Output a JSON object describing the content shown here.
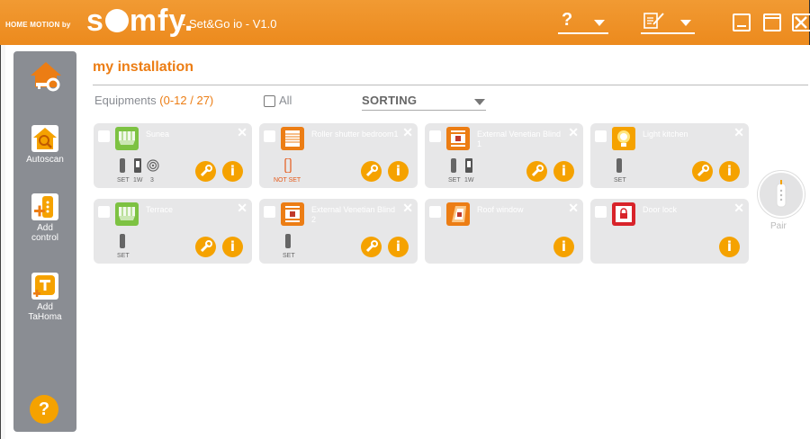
{
  "titlebar": {
    "brand_small": "HOME MOTION by",
    "brand_logo": "somfy.",
    "app_title": "- Set&Go io - V1.0",
    "help_button": "?",
    "edit_icon": "edit-icon",
    "window_buttons": [
      "minimize-icon",
      "maximize-icon",
      "close-icon"
    ],
    "accent_color": "#ec8a1d"
  },
  "sidebar": {
    "home_icon": "home-key-icon",
    "items": [
      {
        "label": "Autoscan",
        "icon": "autoscan-icon"
      },
      {
        "label": "Add control",
        "icon": "add-control-icon"
      },
      {
        "label": "Add TaHoma",
        "icon": "add-tahoma-icon"
      }
    ],
    "help": "?"
  },
  "main": {
    "heading": "my installation",
    "equipments_label": "Equipments",
    "equipments_count": "(0-12 / 27)",
    "all_label": "All",
    "sorting_label": "SORTING"
  },
  "devices": [
    {
      "name": "Sunea",
      "icon": "awning-icon",
      "icon_color": "#7dc242",
      "status": [
        "SET",
        "1W",
        "3"
      ],
      "wrench": true
    },
    {
      "name": "Roller shutter bedroom1",
      "icon": "roller-shutter-icon",
      "icon_color": "#ec7d14",
      "status": [
        "NOT SET"
      ],
      "wrench": true
    },
    {
      "name": "External Venetian Blind 1",
      "icon": "venetian-blind-icon",
      "icon_color": "#ec7d14",
      "status": [
        "SET",
        "1W"
      ],
      "wrench": true
    },
    {
      "name": "Light kitchen",
      "icon": "light-icon",
      "icon_color": "#f5a200",
      "status": [
        "SET"
      ],
      "wrench": true
    },
    {
      "name": "Terrace",
      "icon": "awning-icon",
      "icon_color": "#7dc242",
      "status": [
        "SET"
      ],
      "wrench": true
    },
    {
      "name": "External Venetian Blind 2",
      "icon": "venetian-blind-icon",
      "icon_color": "#ec7d14",
      "status": [
        "SET"
      ],
      "wrench": true
    },
    {
      "name": "Roof window",
      "icon": "roof-window-icon",
      "icon_color": "#ec7d14",
      "status": [],
      "wrench": false
    },
    {
      "name": "Door lock",
      "icon": "door-lock-icon",
      "icon_color": "#d8232a",
      "status": [],
      "wrench": false
    }
  ],
  "pair": {
    "label": "Pair",
    "icon": "remote-icon"
  }
}
